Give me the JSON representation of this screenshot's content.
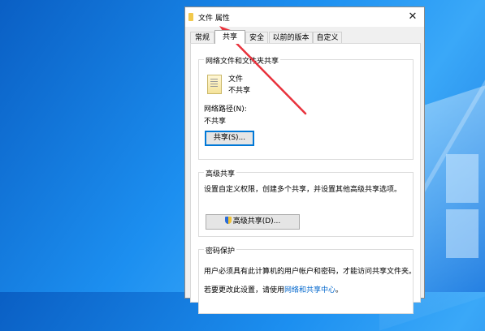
{
  "dialog": {
    "title": "文件 属性",
    "close_symbol": "✕"
  },
  "tabs": [
    {
      "label": "常规"
    },
    {
      "label": "共享"
    },
    {
      "label": "安全"
    },
    {
      "label": "以前的版本"
    },
    {
      "label": "自定义"
    }
  ],
  "network_sharing": {
    "group_title": "网络文件和文件夹共享",
    "item_name": "文件",
    "item_status": "不共享",
    "path_label": "网络路径(N):",
    "path_value": "不共享",
    "share_button": "共享(S)..."
  },
  "advanced_sharing": {
    "group_title": "高级共享",
    "description": "设置自定义权限，创建多个共享，并设置其他高级共享选项。",
    "button": "高级共享(D)..."
  },
  "password_protection": {
    "group_title": "密码保护",
    "description": "用户必须具有此计算机的用户帐户和密码，才能访问共享文件夹。",
    "change_text": "若要更改此设置，请使用",
    "link_text": "网络和共享中心",
    "period": "。"
  },
  "colors": {
    "annotation_arrow": "#e8323c",
    "link": "#0066cc",
    "focus": "#0078d7"
  }
}
